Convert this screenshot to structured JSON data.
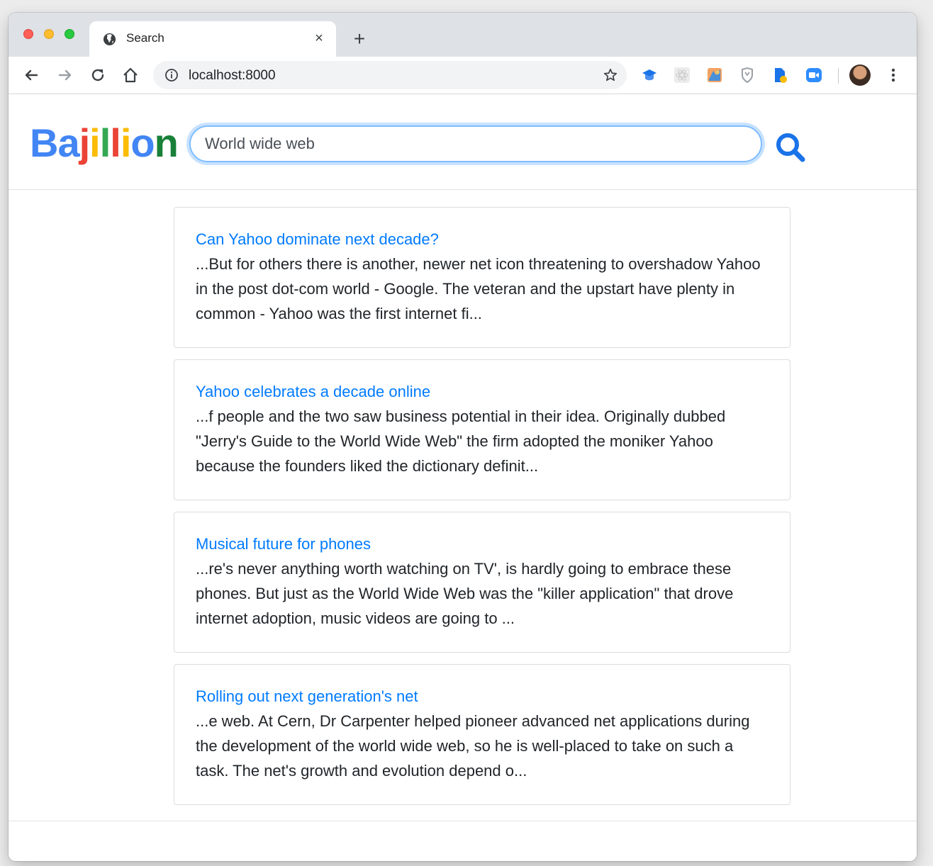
{
  "browser": {
    "tab_title": "Search",
    "tab_close": "×",
    "new_tab": "+",
    "url": "localhost:8000"
  },
  "site": {
    "logo_letters": [
      {
        "char": "B",
        "color": "#4285f4"
      },
      {
        "char": "a",
        "color": "#4285f4"
      },
      {
        "char": "j",
        "color": "#ea4335"
      },
      {
        "char": "i",
        "color": "#fbbc05"
      },
      {
        "char": "l",
        "color": "#34a853"
      },
      {
        "char": "l",
        "color": "#ea4335"
      },
      {
        "char": "i",
        "color": "#fbbc05"
      },
      {
        "char": "o",
        "color": "#4285f4"
      },
      {
        "char": "n",
        "color": "#188038"
      }
    ],
    "search_query": "World wide web"
  },
  "results": [
    {
      "title": "Can Yahoo dominate next decade?",
      "snippet": "...But for others there is another, newer net icon threatening to overshadow Yahoo in the post dot-com world - Google. The veteran and the upstart have plenty in common - Yahoo was the first internet fi..."
    },
    {
      "title": "Yahoo celebrates a decade online",
      "snippet": "...f people and the two saw business potential in their idea. Originally dubbed \"Jerry's Guide to the World Wide Web\" the firm adopted the moniker Yahoo because the founders liked the dictionary definit..."
    },
    {
      "title": "Musical future for phones",
      "snippet": "...re's never anything worth watching on TV', is hardly going to embrace these phones. But just as the World Wide Web was the \"killer application\" that drove internet adoption, music videos are going to ..."
    },
    {
      "title": "Rolling out next generation's net",
      "snippet": "...e web. At Cern, Dr Carpenter helped pioneer advanced net applications during the development of the world wide web, so he is well-placed to take on such a task. The net's growth and evolution depend o..."
    }
  ],
  "colors": {
    "link": "#007bff",
    "focus_ring": "#80bdff",
    "search_icon": "#1a73e8"
  }
}
